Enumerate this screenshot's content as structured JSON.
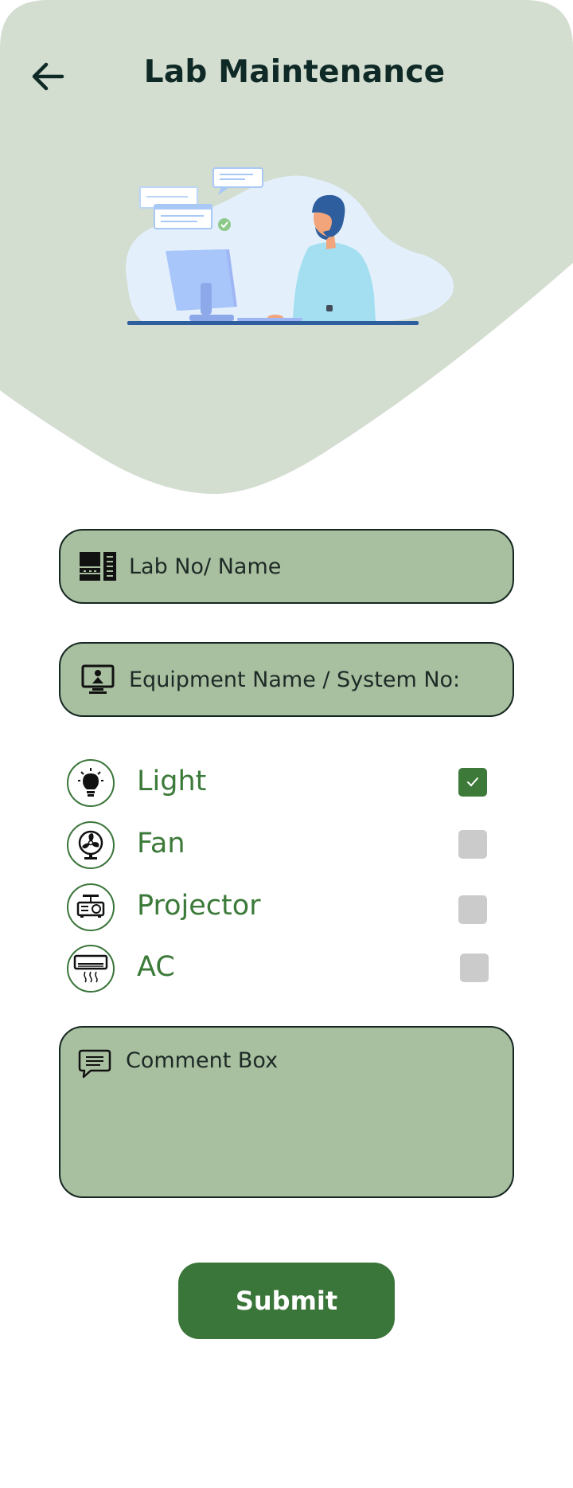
{
  "header": {
    "title": "Lab Maintenance",
    "back_icon": "arrow-left-icon"
  },
  "colors": {
    "header_bg": "#d3ddd0",
    "field_bg": "#a8bfa0",
    "accent": "#3a7539",
    "text_dark": "#0f2a26"
  },
  "form": {
    "lab_field": {
      "placeholder": "Lab No/ Name",
      "value": "",
      "icon": "server-rack-icon"
    },
    "equipment_field": {
      "placeholder": "Equipment Name / System No:",
      "value": "",
      "icon": "computer-monitor-icon"
    },
    "options": [
      {
        "label": "Light",
        "icon": "light-bulb-icon",
        "checked": true
      },
      {
        "label": "Fan",
        "icon": "fan-icon",
        "checked": false
      },
      {
        "label": "Projector",
        "icon": "projector-icon",
        "checked": false
      },
      {
        "label": "AC",
        "icon": "air-conditioner-icon",
        "checked": false
      }
    ],
    "comment": {
      "placeholder": "Comment Box",
      "value": "",
      "icon": "comment-icon"
    },
    "submit_label": "Submit"
  }
}
